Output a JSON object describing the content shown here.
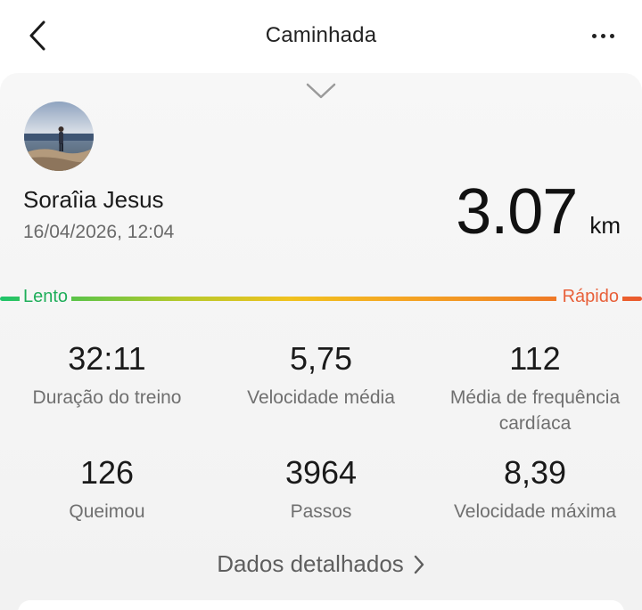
{
  "header": {
    "title": "Caminhada",
    "back_icon": "chevron-left-icon",
    "more_icon": "more-horizontal-icon"
  },
  "workout": {
    "user_name": "Soraîia Jesus",
    "datetime": "16/04/2026, 12:04",
    "distance_value": "3.07",
    "distance_unit": "km"
  },
  "speed_scale": {
    "slow_label": "Lento",
    "fast_label": "Rápido",
    "colors": [
      "#1ec46a",
      "#f0c21e",
      "#ea5a2e"
    ]
  },
  "stats": [
    {
      "value": "32:11",
      "label": "Duração do treino"
    },
    {
      "value": "5,75",
      "label": "Velocidade média"
    },
    {
      "value": "112",
      "label": "Média de frequência cardíaca"
    },
    {
      "value": "126",
      "label": "Queimou"
    },
    {
      "value": "3964",
      "label": "Passos"
    },
    {
      "value": "8,39",
      "label": "Velocidade máxima"
    }
  ],
  "details_link": {
    "label": "Dados detalhados",
    "icon": "chevron-right-icon"
  }
}
